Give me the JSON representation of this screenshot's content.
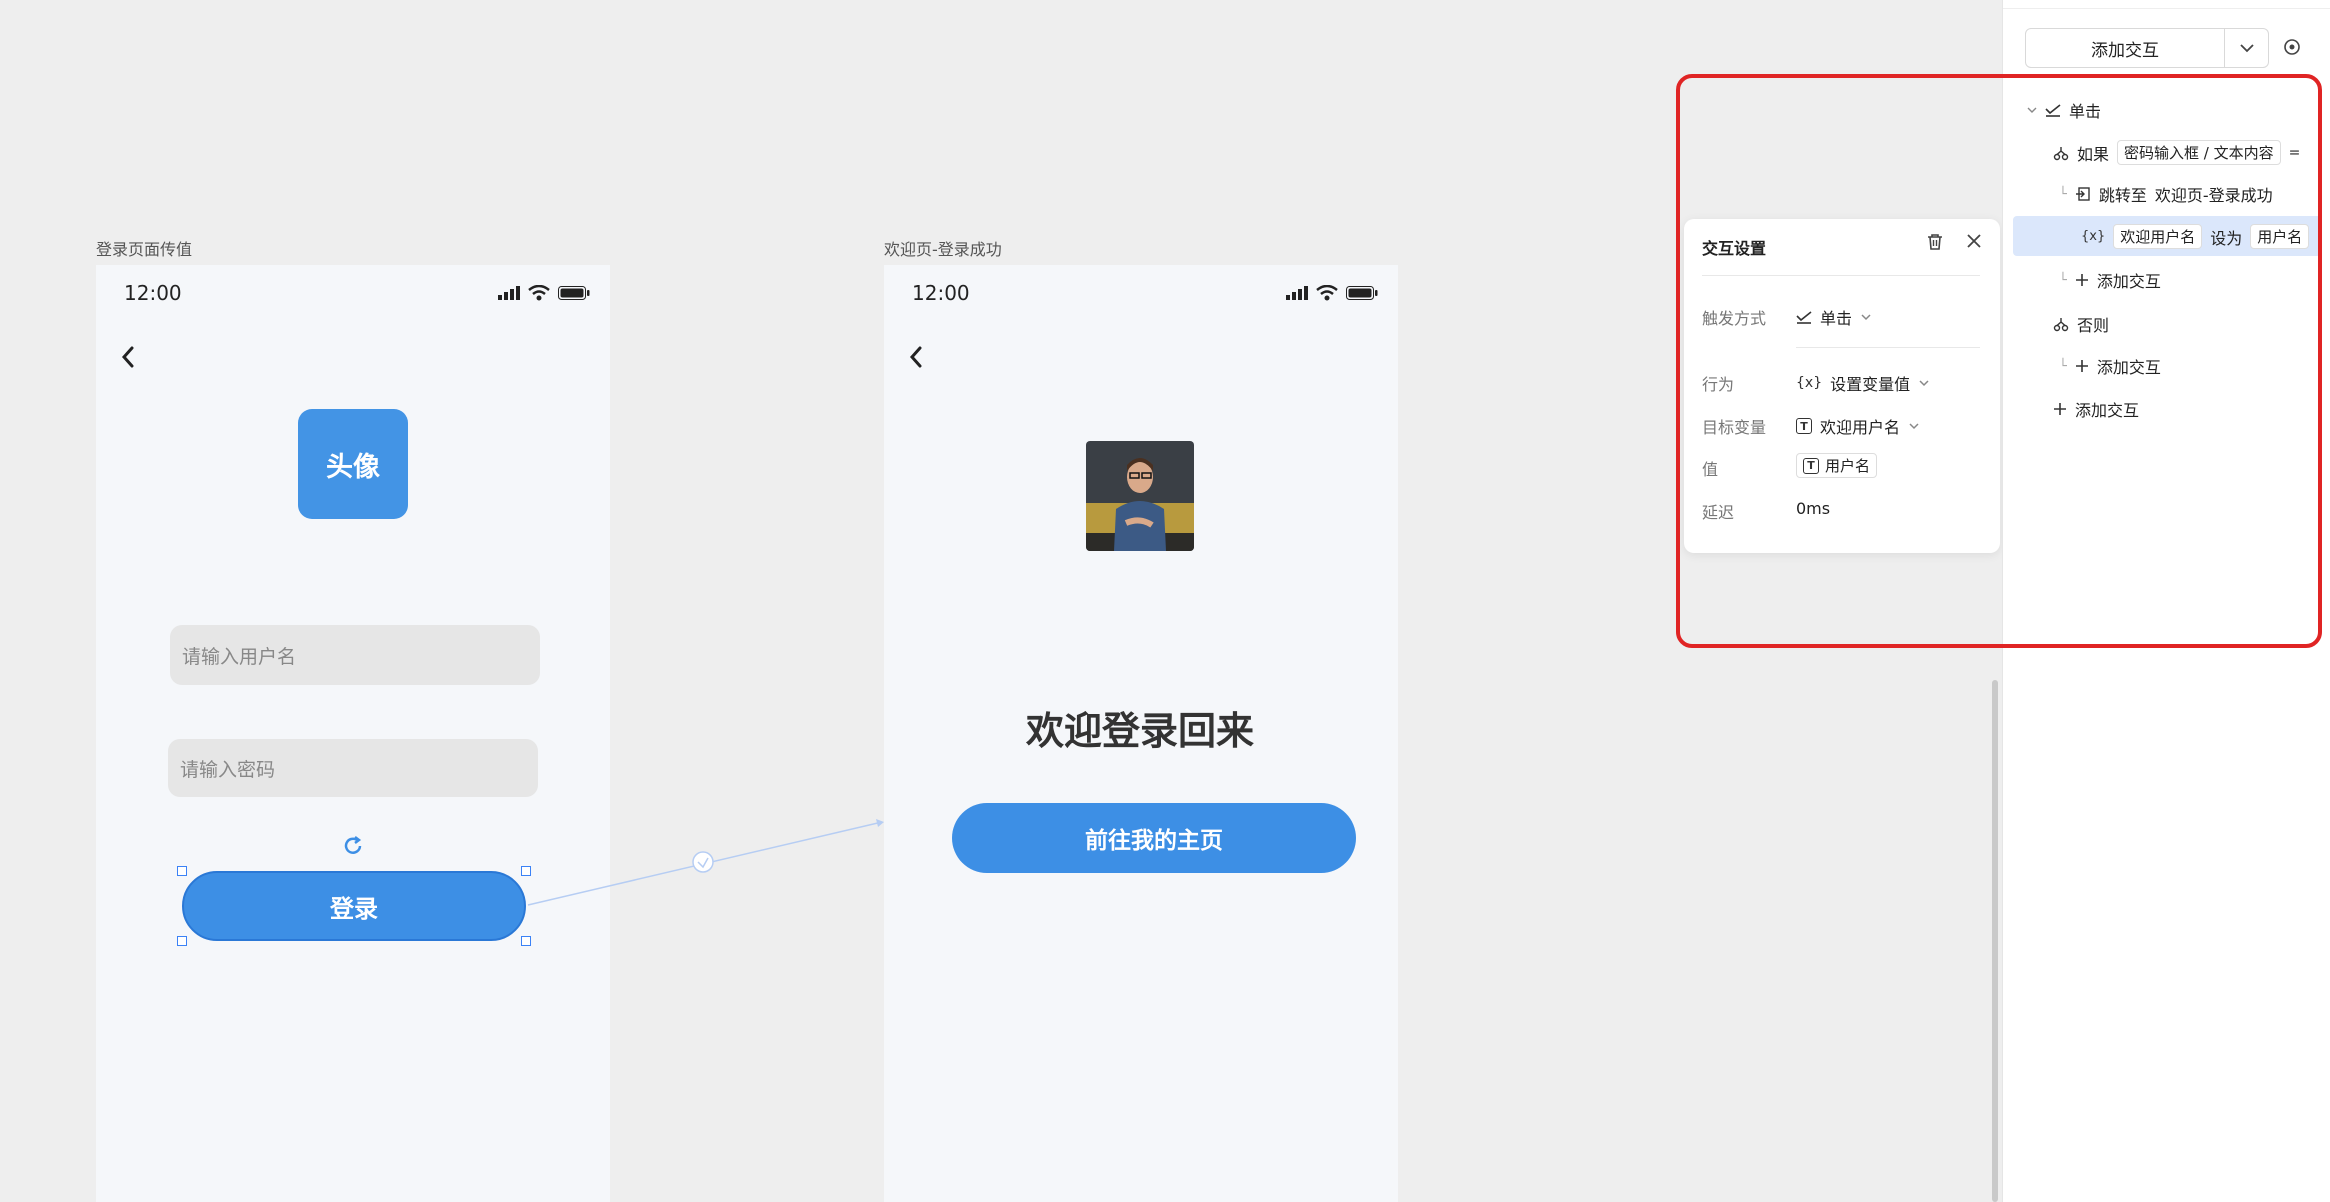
{
  "frame1": {
    "label": "登录页面传值",
    "time": "12:00",
    "avatar_text": "头像",
    "username_placeholder": "请输入用户名",
    "password_placeholder": "请输入密码",
    "login_label": "登录"
  },
  "frame2": {
    "label": "欢迎页-登录成功",
    "time": "12:00",
    "welcome_title": "欢迎登录回来",
    "home_button": "前往我的主页"
  },
  "popover": {
    "title": "交互设置",
    "trigger_label": "触发方式",
    "trigger_value": "单击",
    "action_label": "行为",
    "action_value": "设置变量值",
    "target_label": "目标变量",
    "target_value": "欢迎用户名",
    "value_label": "值",
    "value_value": "用户名",
    "delay_label": "延迟",
    "delay_value": "0ms"
  },
  "panel": {
    "add_interaction": "添加交互",
    "tree": {
      "event": "单击",
      "if_label": "如果",
      "if_condition": "密码输入框 / 文本内容",
      "if_op": "=",
      "jump_label": "跳转至",
      "jump_target": "欢迎页-登录成功",
      "set_var": "欢迎用户名",
      "set_to": "设为",
      "set_value": "用户名",
      "add_inner": "添加交互",
      "else_label": "否则",
      "add_else": "添加交互",
      "add_root": "添加交互"
    }
  },
  "colors": {
    "accent": "#3d8fe5",
    "highlight": "#dbe7fb",
    "annotation_red": "#e02424"
  }
}
